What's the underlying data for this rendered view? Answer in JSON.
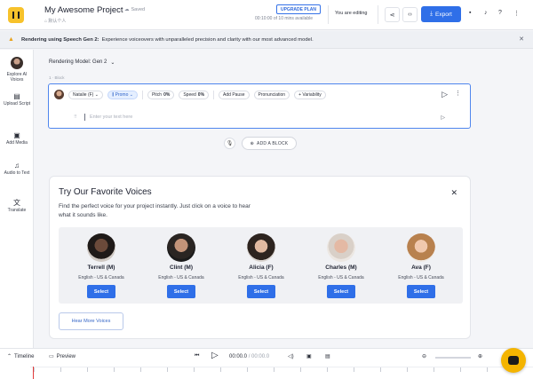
{
  "header": {
    "project_title": "My Awesome Project",
    "saved_label": "Saved",
    "subline": "⌂ 默认个人",
    "upgrade_label": "UPGRADE PLAN",
    "minutes_label": "00:10:00 of 10 mins available",
    "editing_label": "You are editing",
    "export_label": "Export",
    "share_icon": "share-icon",
    "embed_icon": "code-icon"
  },
  "banner": {
    "bold_text": "Rendering using Speech Gen 2:",
    "text": "Experience voiceovers with unparalleled precision and clarity with our most advanced model."
  },
  "sidebar": {
    "items": [
      {
        "label": "Explore AI Voices",
        "icon": "avatar-icon"
      },
      {
        "label": "Upload Script",
        "icon": "document-icon"
      },
      {
        "label": "Add Media",
        "icon": "folder-icon"
      },
      {
        "label": "Audio to Text",
        "icon": "audio-file-icon"
      },
      {
        "label": "Translate",
        "icon": "translate-icon"
      }
    ]
  },
  "editor": {
    "rendering_model": "Rendering Model: Gen 2",
    "block_label": "1 · Block",
    "voice_name": "Natalie (F)",
    "style": "Promo",
    "pitch_label": "Pitch",
    "pitch_value": "0%",
    "speed_label": "Speed",
    "speed_value": "0%",
    "add_pause": "Add Pause",
    "pronunciation": "Pronunciation",
    "variability": "Variability",
    "placeholder": "Enter your text here",
    "add_block": "ADD A BLOCK"
  },
  "favorites": {
    "title": "Try Our Favorite Voices",
    "description": "Find the perfect voice for your project instantly. Just click on a voice to hear what it sounds like.",
    "select_label": "Select",
    "voices": [
      {
        "name": "Terrell (M)",
        "lang": "English - US & Canada"
      },
      {
        "name": "Clint (M)",
        "lang": "English - US & Canada"
      },
      {
        "name": "Alicia (F)",
        "lang": "English - US & Canada"
      },
      {
        "name": "Charles (M)",
        "lang": "English - US & Canada"
      },
      {
        "name": "Ava (F)",
        "lang": "English - US & Canada"
      }
    ],
    "hear_more": "Hear More Voices"
  },
  "player": {
    "timeline_label": "Timeline",
    "preview_label": "Preview",
    "current_time": "00:00.0",
    "total_time": "/ 00:00.0"
  },
  "colors": {
    "accent": "#2f6fe8",
    "brand": "#f7c22b",
    "chat": "#f4b400"
  }
}
